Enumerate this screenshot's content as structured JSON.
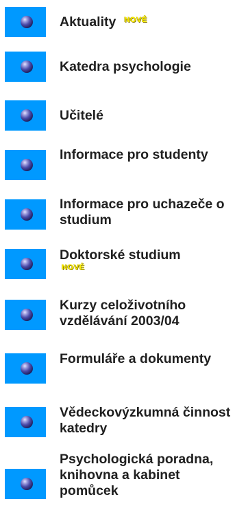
{
  "badge_text": "NOVÉ",
  "menu": [
    {
      "label": "Aktuality",
      "badge": true
    },
    {
      "label": "Katedra psychologie"
    },
    {
      "label": "Učitelé"
    },
    {
      "label": "Informace pro studenty"
    },
    {
      "label": "Informace pro uchazeče o studium"
    },
    {
      "label": "Doktorské studium",
      "badge": true
    },
    {
      "label": "Kurzy celoživotního vzdělávání 2003/04"
    },
    {
      "label": "Formuláře a dokumenty"
    },
    {
      "label": "Vědeckovýzkumná činnost katedry"
    },
    {
      "label": "Psychologická poradna, knihovna a kabinet pomůcek"
    }
  ],
  "colors": {
    "tile": "#0099ff",
    "badge": "#fff200",
    "text": "#202020"
  }
}
